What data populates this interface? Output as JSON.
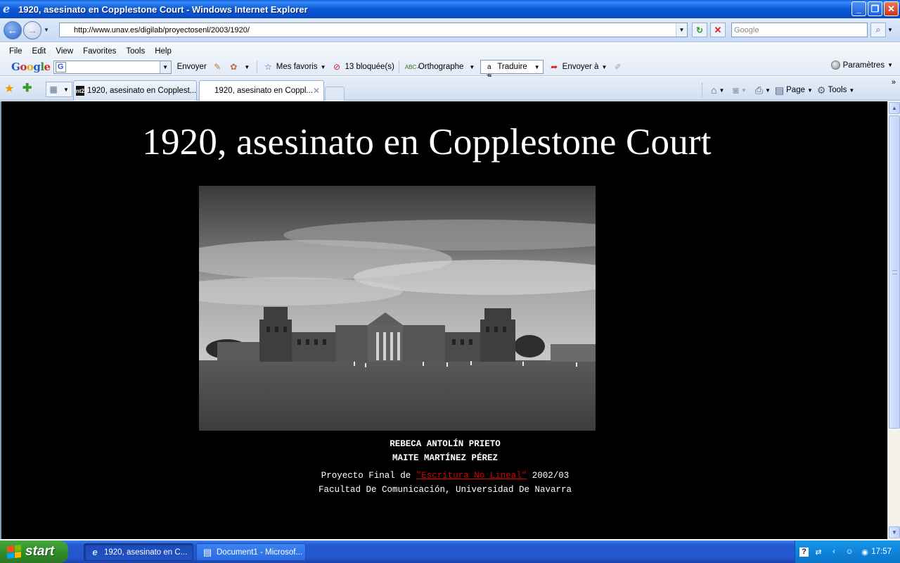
{
  "window": {
    "title": "1920, asesinato en Copplestone Court - Windows Internet Explorer",
    "app_icon": "ie-icon"
  },
  "address_bar": {
    "url": "http://www.unav.es/digilab/proyectosenl/2003/1920/",
    "search_placeholder": "Google"
  },
  "menu": {
    "items": [
      "File",
      "Edit",
      "View",
      "Favorites",
      "Tools",
      "Help"
    ]
  },
  "google_toolbar": {
    "search_button": "Envoyer",
    "favorites": "Mes favoris",
    "blocked": "13 bloquée(s)",
    "spelling": "Orthographe",
    "translate": "Traduire",
    "send_to": "Envoyer à",
    "settings": "Paramètres"
  },
  "tabs": [
    {
      "label": "1920, asesinato en Copplest..."
    },
    {
      "label": "1920, asesinato en Coppl..."
    }
  ],
  "command_bar": {
    "page": "Page",
    "tools": "Tools"
  },
  "content": {
    "title": "1920, asesinato en Copplestone Court",
    "authors": [
      "REBECA ANTOLÍN PRIETO",
      "MAITE MARTÍNEZ PÉREZ"
    ],
    "project_prefix": "Proyecto Final de ",
    "project_link": "\"Escritura No Lineal\"",
    "project_suffix": " 2002/03",
    "faculty": "Facultad De Comunicación, Universidad De Navarra"
  },
  "taskbar": {
    "start": "start",
    "tasks": [
      {
        "label": "1920, asesinato en C...",
        "icon": "ie-icon"
      },
      {
        "label": "Document1 - Microsof...",
        "icon": "word-icon"
      }
    ],
    "clock": "17:57"
  },
  "colors": {
    "page_background": "#000000",
    "link": "#d50000",
    "title_bar": "#0c5bd8"
  }
}
